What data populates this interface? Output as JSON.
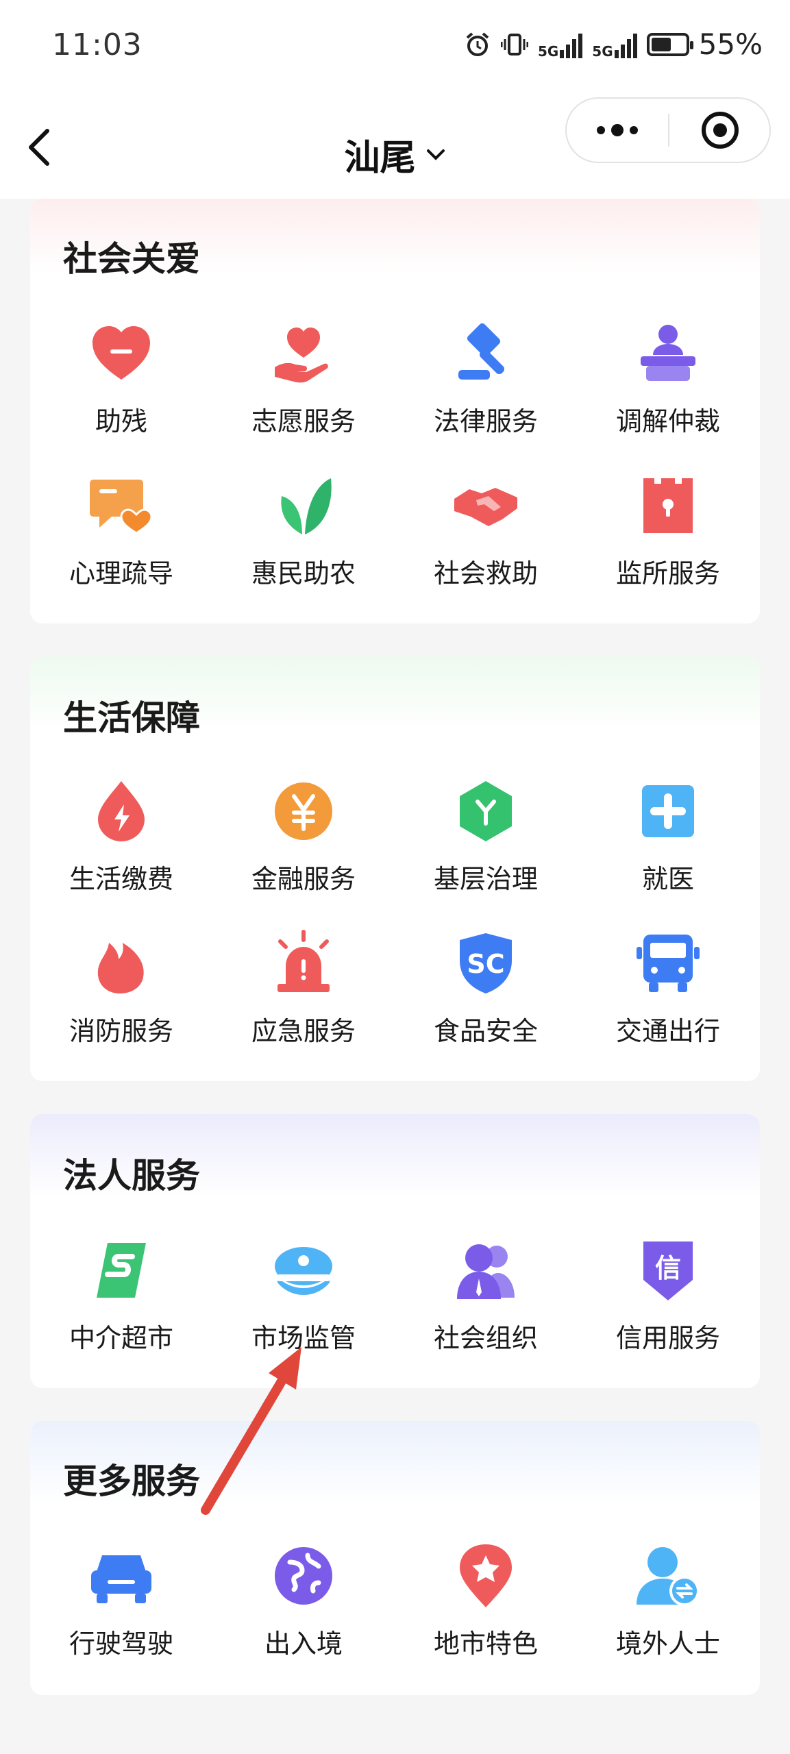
{
  "status": {
    "time": "11:03",
    "signal1": "5G",
    "signal2": "5G",
    "battery": "55%"
  },
  "nav": {
    "title": "汕尾"
  },
  "sections": [
    {
      "title": "社会关爱",
      "items": [
        {
          "label": "助残",
          "icon": "heart-icon"
        },
        {
          "label": "志愿服务",
          "icon": "hand-heart-icon"
        },
        {
          "label": "法律服务",
          "icon": "gavel-icon"
        },
        {
          "label": "调解仲裁",
          "icon": "mediator-icon"
        },
        {
          "label": "心理疏导",
          "icon": "chat-heart-icon"
        },
        {
          "label": "惠民助农",
          "icon": "leaf-icon"
        },
        {
          "label": "社会救助",
          "icon": "handshake-icon"
        },
        {
          "label": "监所服务",
          "icon": "lock-door-icon"
        }
      ]
    },
    {
      "title": "生活保障",
      "items": [
        {
          "label": "生活缴费",
          "icon": "energy-drop-icon"
        },
        {
          "label": "金融服务",
          "icon": "yuan-icon"
        },
        {
          "label": "基层治理",
          "icon": "hexagon-icon"
        },
        {
          "label": "就医",
          "icon": "medical-cross-icon"
        },
        {
          "label": "消防服务",
          "icon": "flame-icon"
        },
        {
          "label": "应急服务",
          "icon": "alarm-icon"
        },
        {
          "label": "食品安全",
          "icon": "shield-sc-icon"
        },
        {
          "label": "交通出行",
          "icon": "bus-icon"
        }
      ]
    },
    {
      "title": "法人服务",
      "items": [
        {
          "label": "中介超市",
          "icon": "s-logo-icon"
        },
        {
          "label": "市场监管",
          "icon": "police-cap-icon"
        },
        {
          "label": "社会组织",
          "icon": "group-icon"
        },
        {
          "label": "信用服务",
          "icon": "credit-shield-icon"
        }
      ]
    },
    {
      "title": "更多服务",
      "items": [
        {
          "label": "行驶驾驶",
          "icon": "car-icon"
        },
        {
          "label": "出入境",
          "icon": "globe-icon"
        },
        {
          "label": "地市特色",
          "icon": "location-star-icon"
        },
        {
          "label": "境外人士",
          "icon": "foreigner-icon"
        }
      ]
    }
  ],
  "colors": {
    "red": "#ee5a5a",
    "blue": "#3d7cf2",
    "orange": "#f39a3a",
    "green": "#34c26e",
    "purple": "#7a5ce8",
    "sky": "#4fb4f5"
  }
}
